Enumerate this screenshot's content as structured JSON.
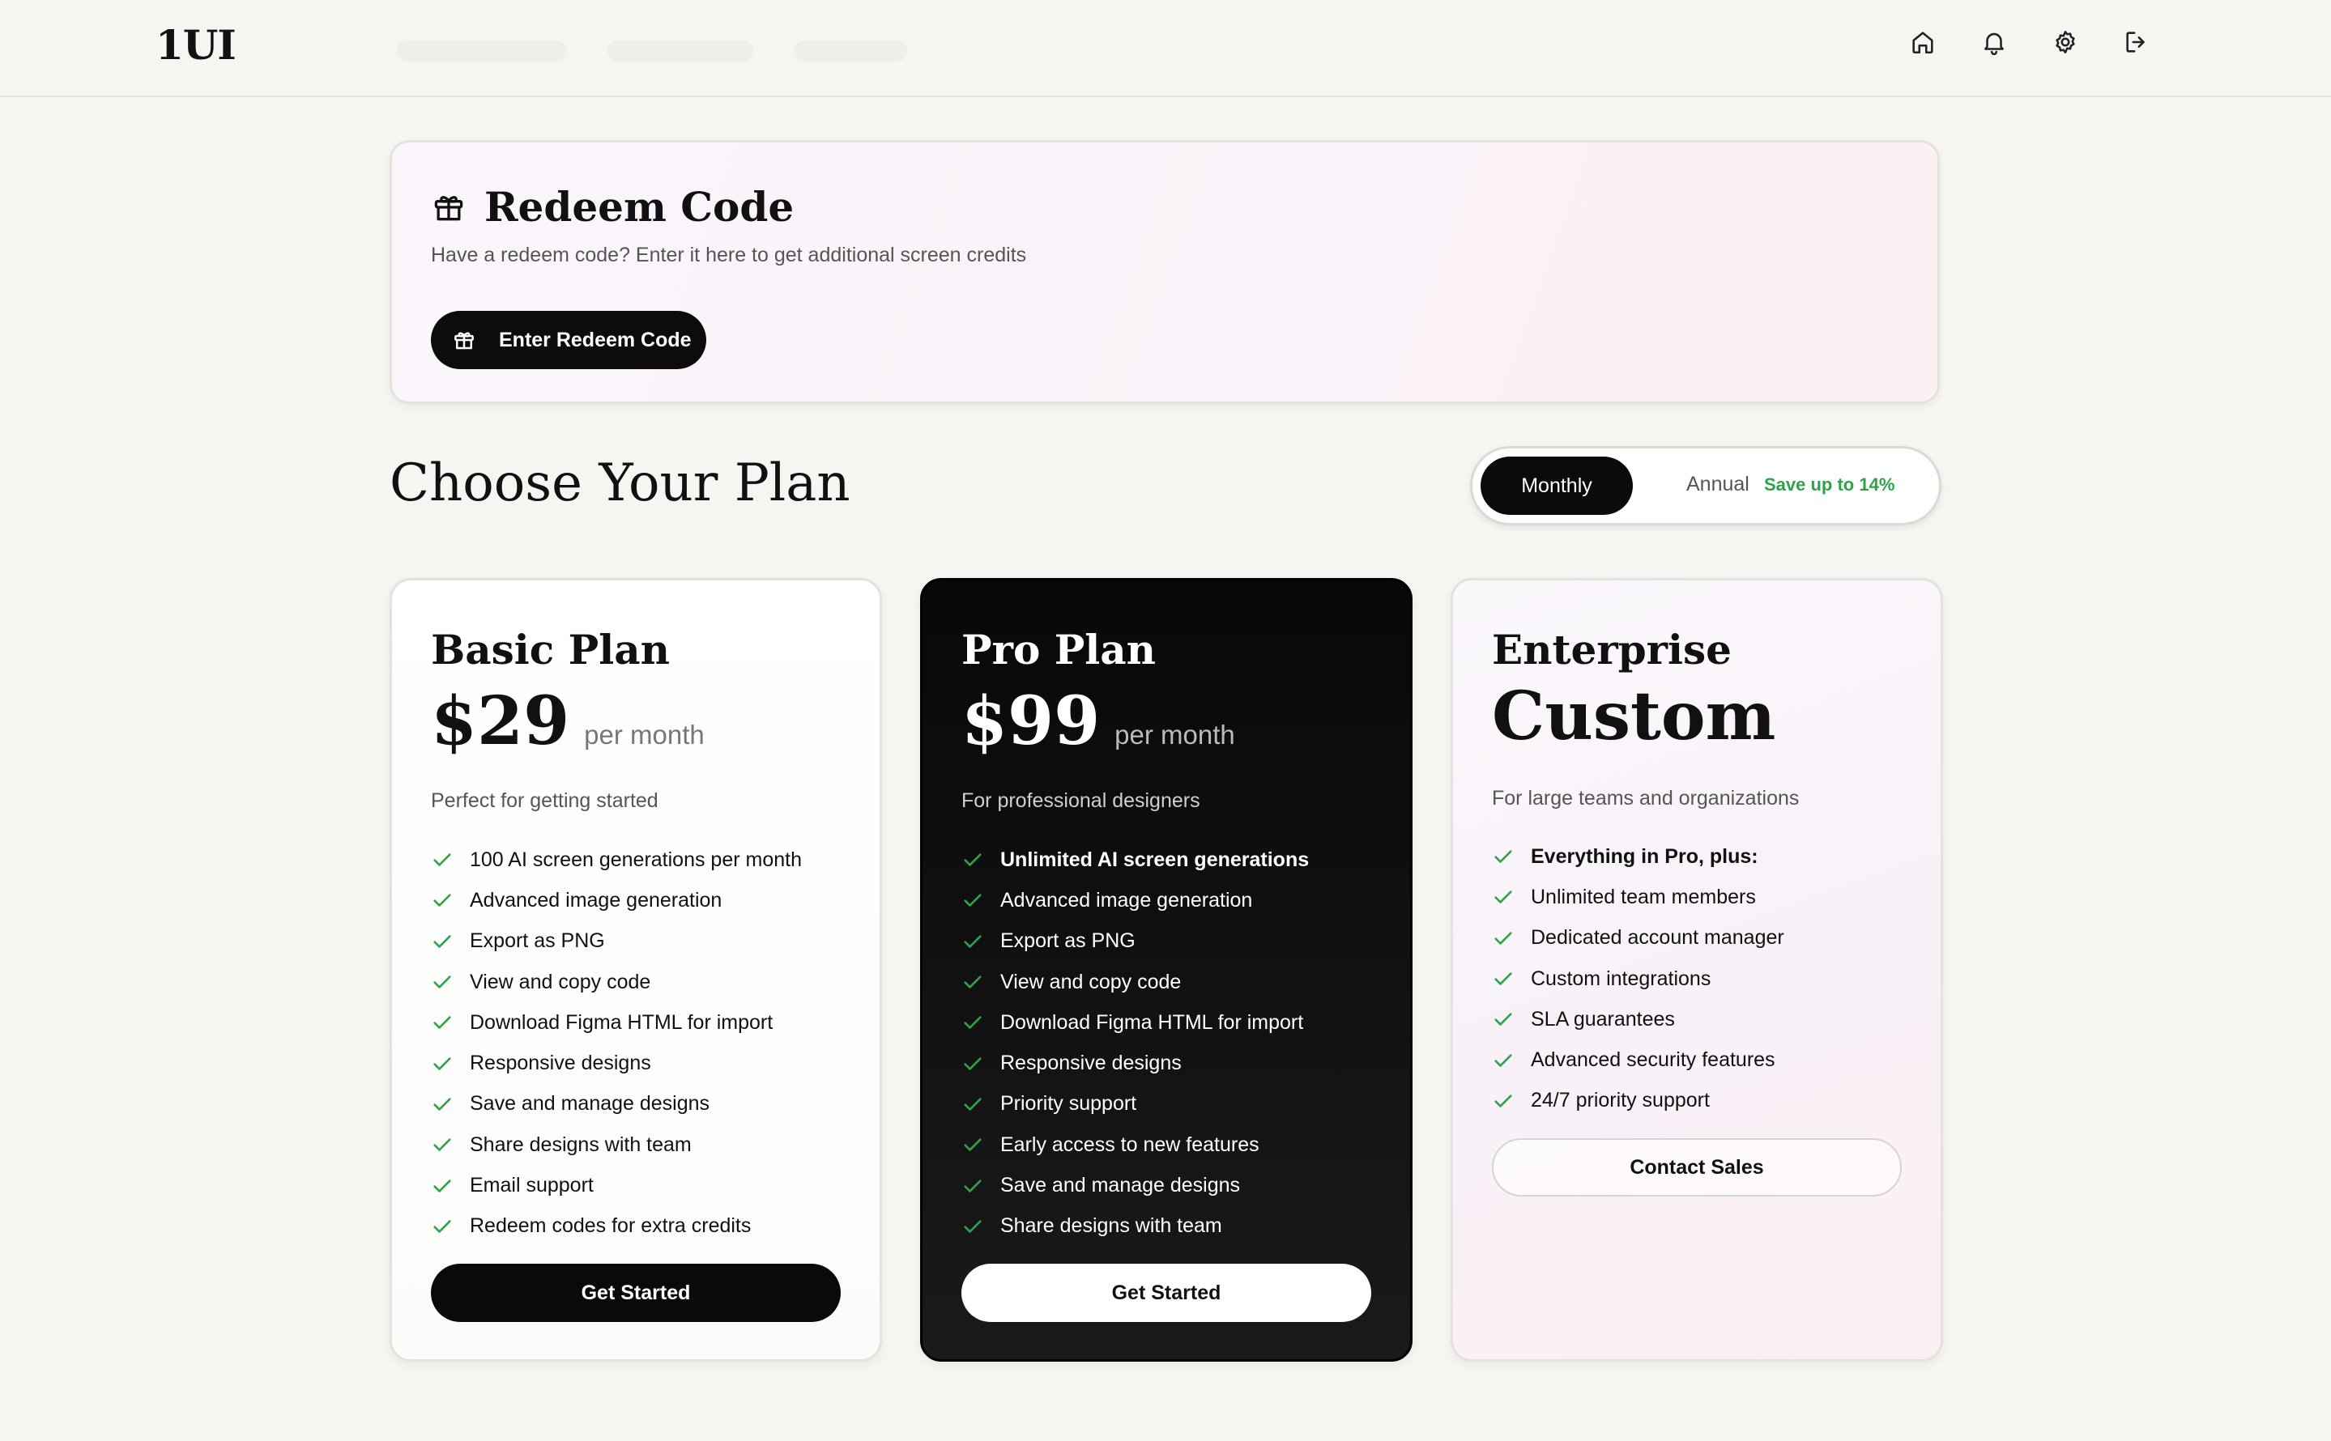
{
  "header": {
    "logo": "1UI",
    "icons": [
      "home-icon",
      "bell-icon",
      "gear-icon",
      "logout-icon"
    ]
  },
  "redeem": {
    "title": "Redeem Code",
    "description": "Have a redeem code? Enter it here to get additional screen credits",
    "button_label": "Enter Redeem Code"
  },
  "plans_section": {
    "title": "Choose Your Plan",
    "toggle": {
      "monthly": "Monthly",
      "annual": "Annual",
      "save": "Save up to 14%",
      "selected": "Monthly"
    }
  },
  "plans": {
    "basic": {
      "name": "Basic Plan",
      "price": "$29",
      "period": "per month",
      "description": "Perfect for getting started",
      "features": [
        "100 AI screen generations per month",
        "Advanced image generation",
        "Export as PNG",
        "View and copy code",
        "Download Figma HTML for import",
        "Responsive designs",
        "Save and manage designs",
        "Share designs with team",
        "Email support",
        "Redeem codes for extra credits"
      ],
      "button": "Get Started"
    },
    "pro": {
      "name": "Pro Plan",
      "price": "$99",
      "period": "per month",
      "description": "For professional designers",
      "features": [
        "Unlimited AI screen generations",
        "Advanced image generation",
        "Export as PNG",
        "View and copy code",
        "Download Figma HTML for import",
        "Responsive designs",
        "Priority support",
        "Early access to new features",
        "Save and manage designs",
        "Share designs with team"
      ],
      "button": "Get Started"
    },
    "enterprise": {
      "name": "Enterprise",
      "price": "Custom",
      "description": "For large teams and organizations",
      "features": [
        "Everything in Pro, plus:",
        "Unlimited team members",
        "Dedicated account manager",
        "Custom integrations",
        "SLA guarantees",
        "Advanced security features",
        "24/7 priority support"
      ],
      "button": "Contact Sales"
    }
  },
  "colors": {
    "background": "#f6f5f1",
    "check": "#2fa24b",
    "save_text": "#2fa24b",
    "dark": "#0b0b0b"
  }
}
